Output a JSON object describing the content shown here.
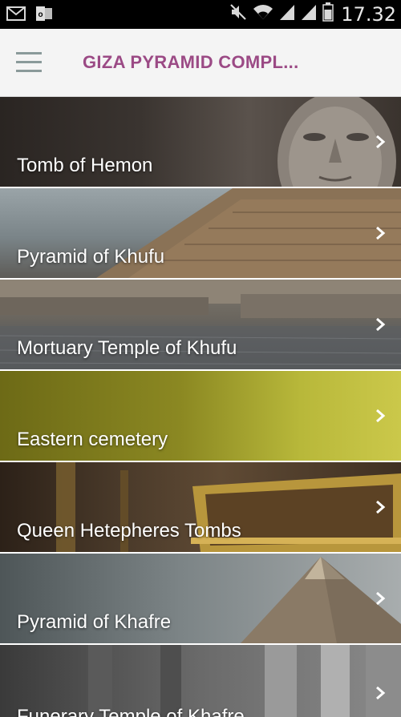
{
  "status_bar": {
    "time": "17.32",
    "left_icons": [
      "mail-icon",
      "outlook-icon"
    ],
    "right_icons": [
      "mute-icon",
      "wifi-icon",
      "signal-icon",
      "signal-icon",
      "battery-icon"
    ]
  },
  "app_bar": {
    "menu_icon": "hamburger-menu-icon",
    "title": "GIZA PYRAMID COMPL..."
  },
  "items": [
    {
      "label": "Tomb of Hemon",
      "icon": "chevron-right-icon"
    },
    {
      "label": "Pyramid of Khufu",
      "icon": "chevron-right-icon"
    },
    {
      "label": "Mortuary Temple of Khufu",
      "icon": "chevron-right-icon"
    },
    {
      "label": "Eastern cemetery",
      "icon": "chevron-right-icon"
    },
    {
      "label": "Queen Hetepheres Tombs",
      "icon": "chevron-right-icon"
    },
    {
      "label": "Pyramid of Khafre",
      "icon": "chevron-right-icon"
    },
    {
      "label": "Funerary Temple of Khafre",
      "icon": "chevron-right-icon"
    }
  ],
  "colors": {
    "title": "#9b4a85",
    "menu_icon": "#8a9a9a",
    "status_bar": "#000000",
    "eastern_cemetery_tint": "#b8b83a"
  }
}
